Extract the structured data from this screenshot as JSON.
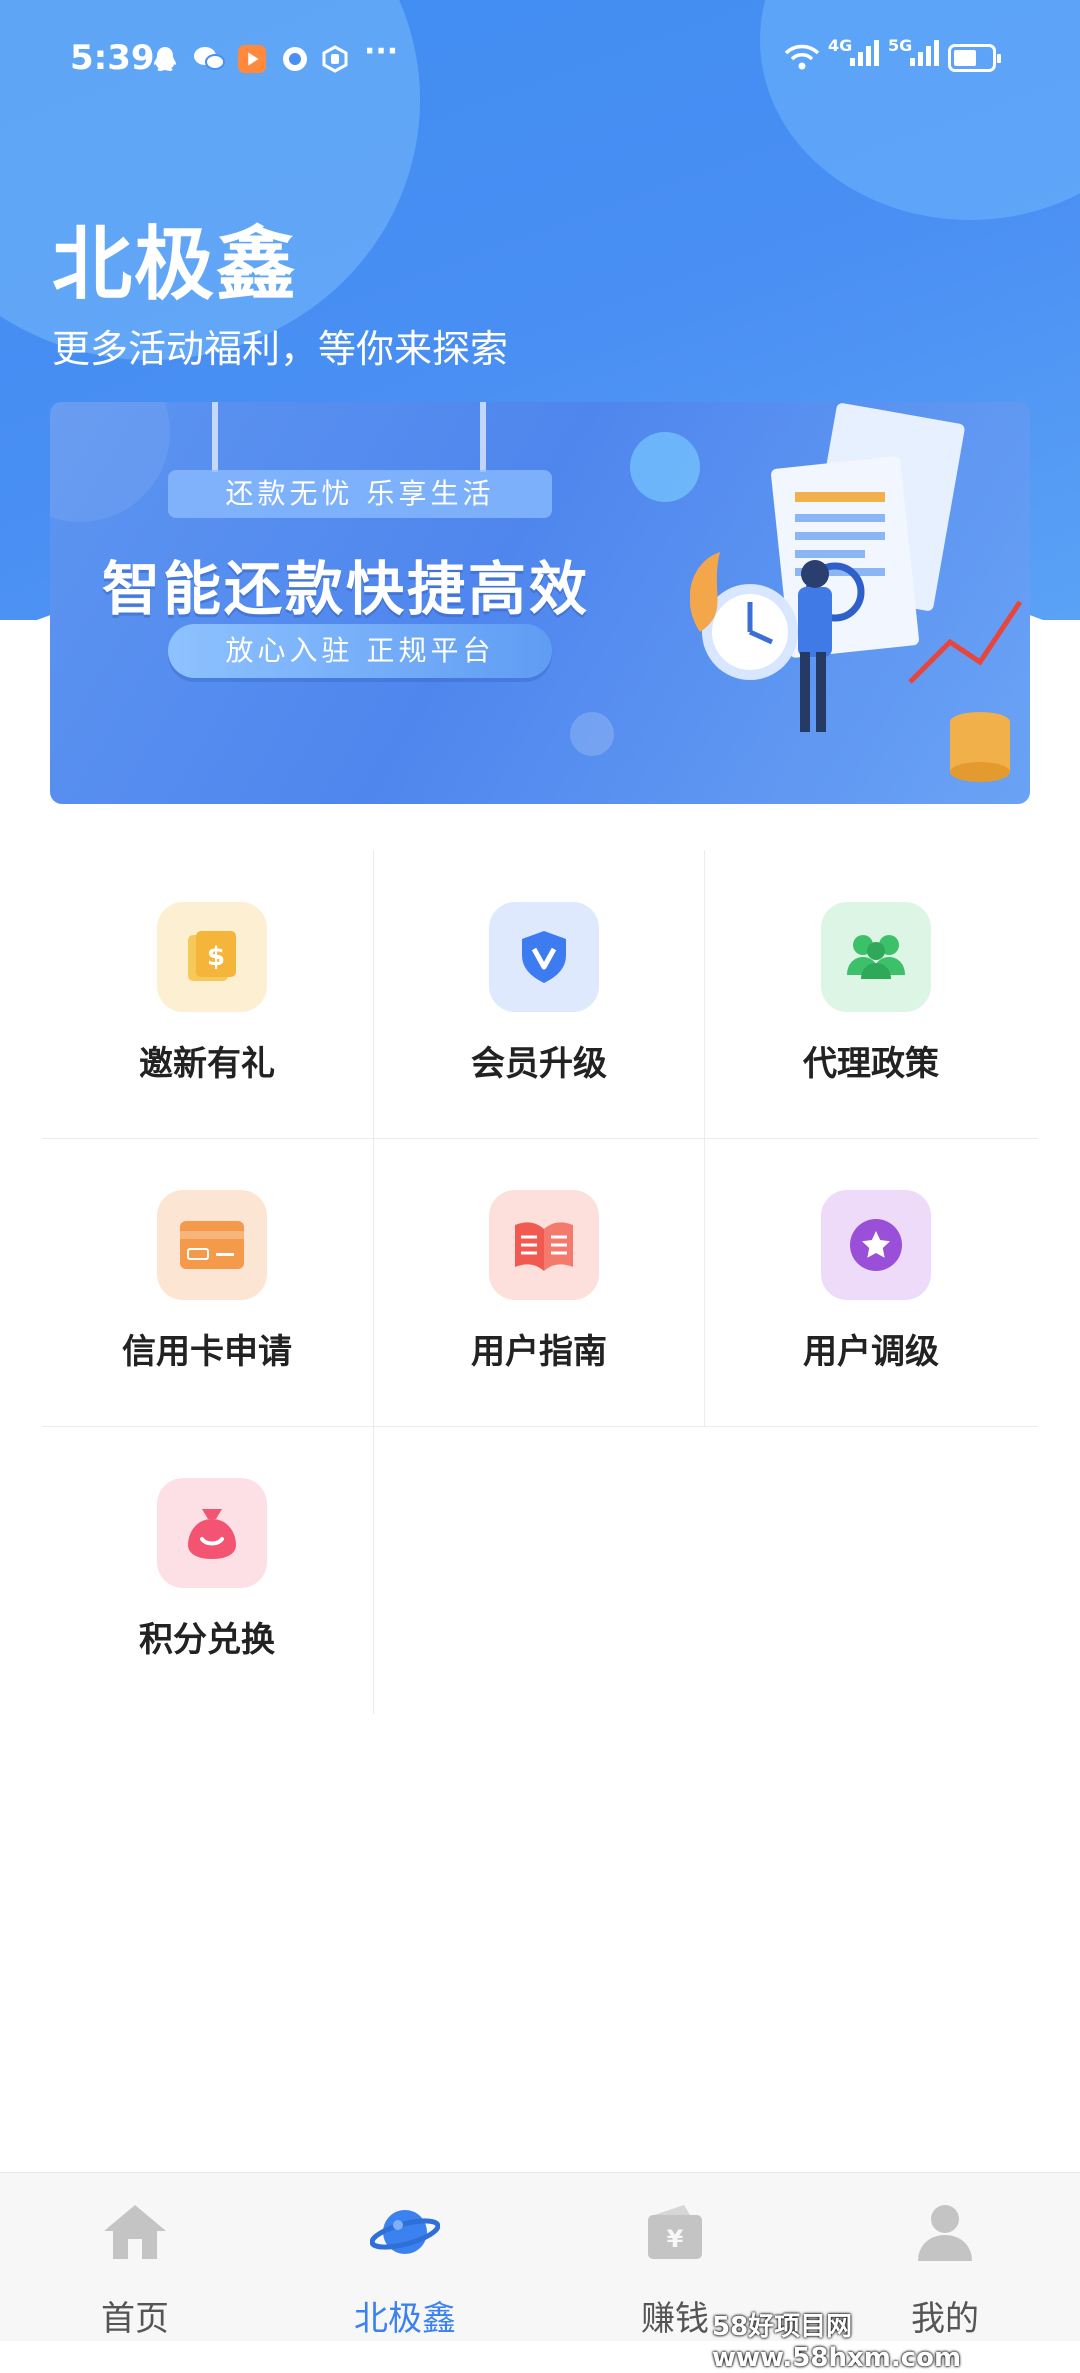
{
  "status_bar": {
    "time": "5:39",
    "net1": "4G",
    "net2": "5G"
  },
  "header": {
    "title": "北极鑫",
    "subtitle": "更多活动福利，等你来探索"
  },
  "banner": {
    "tag": "还款无忧 乐享生活",
    "headline": "智能还款快捷高效",
    "cta": "放心入驻 正规平台"
  },
  "grid": {
    "items": [
      {
        "label": "邀新有礼",
        "icon": "money-file-icon",
        "color": "#f5b53a"
      },
      {
        "label": "会员升级",
        "icon": "vip-shield-icon",
        "color": "#3d7bf0"
      },
      {
        "label": "代理政策",
        "icon": "people-icon",
        "color": "#3cc06a"
      },
      {
        "label": "信用卡申请",
        "icon": "credit-card-icon",
        "color": "#f59a4a"
      },
      {
        "label": "用户指南",
        "icon": "book-icon",
        "color": "#f05a50"
      },
      {
        "label": "用户调级",
        "icon": "star-badge-icon",
        "color": "#9a4fd8"
      },
      {
        "label": "积分兑换",
        "icon": "money-bag-icon",
        "color": "#f25472"
      }
    ]
  },
  "tabs": [
    {
      "label": "首页",
      "icon": "home-icon"
    },
    {
      "label": "北极鑫",
      "icon": "planet-icon",
      "active": true
    },
    {
      "label": "赚钱",
      "icon": "wallet-icon"
    },
    {
      "label": "我的",
      "icon": "user-icon"
    }
  ],
  "watermark": "58好项目网www.58hxm.com"
}
